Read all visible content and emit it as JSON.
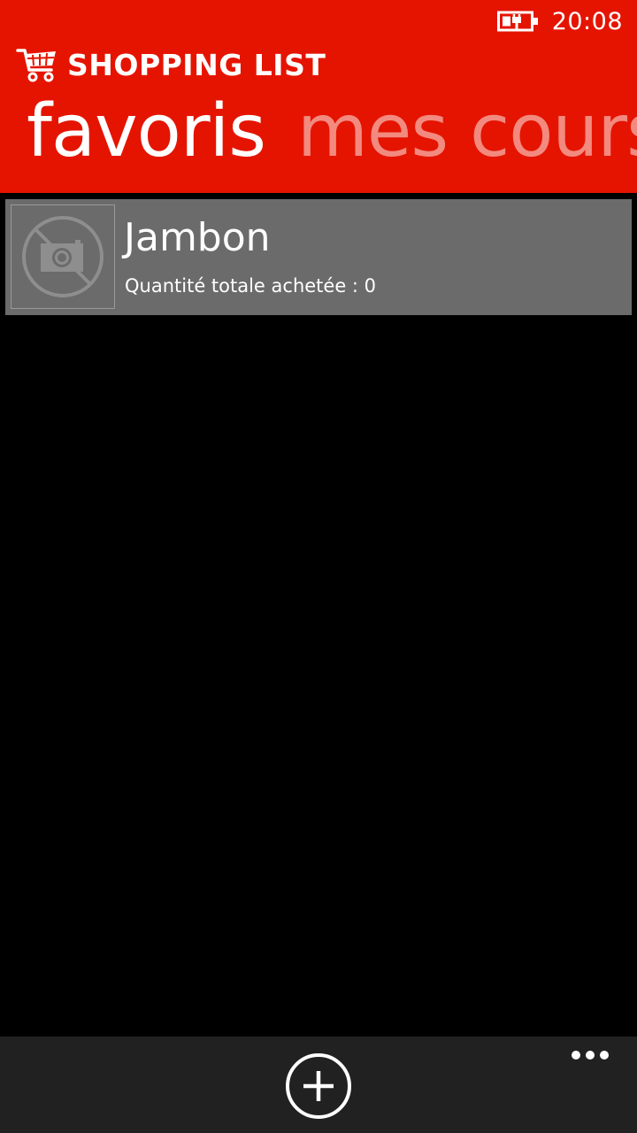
{
  "status": {
    "time": "20:08",
    "battery_icon": "battery-charging-icon"
  },
  "app": {
    "title": "SHOPPING LIST",
    "logo_icon": "shopping-cart-icon",
    "accent_color": "#e51400"
  },
  "pivot": {
    "tabs": [
      {
        "label": "favoris",
        "active": true
      },
      {
        "label": "mes courses",
        "active": false
      }
    ]
  },
  "favorites": {
    "items": [
      {
        "name": "Jambon",
        "subtitle": "Quantité totale achetée : 0",
        "thumbnail_icon": "no-photo-icon"
      }
    ]
  },
  "app_bar": {
    "add_icon": "add-icon",
    "more_icon": "more-icon"
  }
}
